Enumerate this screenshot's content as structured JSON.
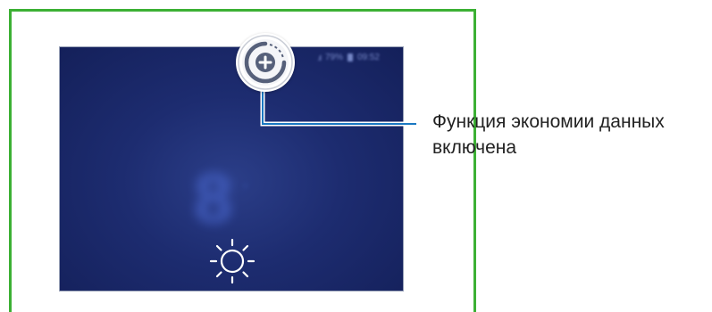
{
  "status_bar": {
    "signal": ".ıl",
    "battery_percent": "79%",
    "time": "09:52"
  },
  "lock_screen": {
    "clock_digit": "8",
    "degree_mark": "°",
    "weather_icon": "sun-icon"
  },
  "indicator": {
    "icon": "data-saver-icon"
  },
  "callout": {
    "label_line1": "Функция экономии данных",
    "label_line2": "включена"
  },
  "colors": {
    "frame_border": "#3cb034",
    "screen_background": "#1d2c70",
    "callout_line": "#1a78c2"
  }
}
